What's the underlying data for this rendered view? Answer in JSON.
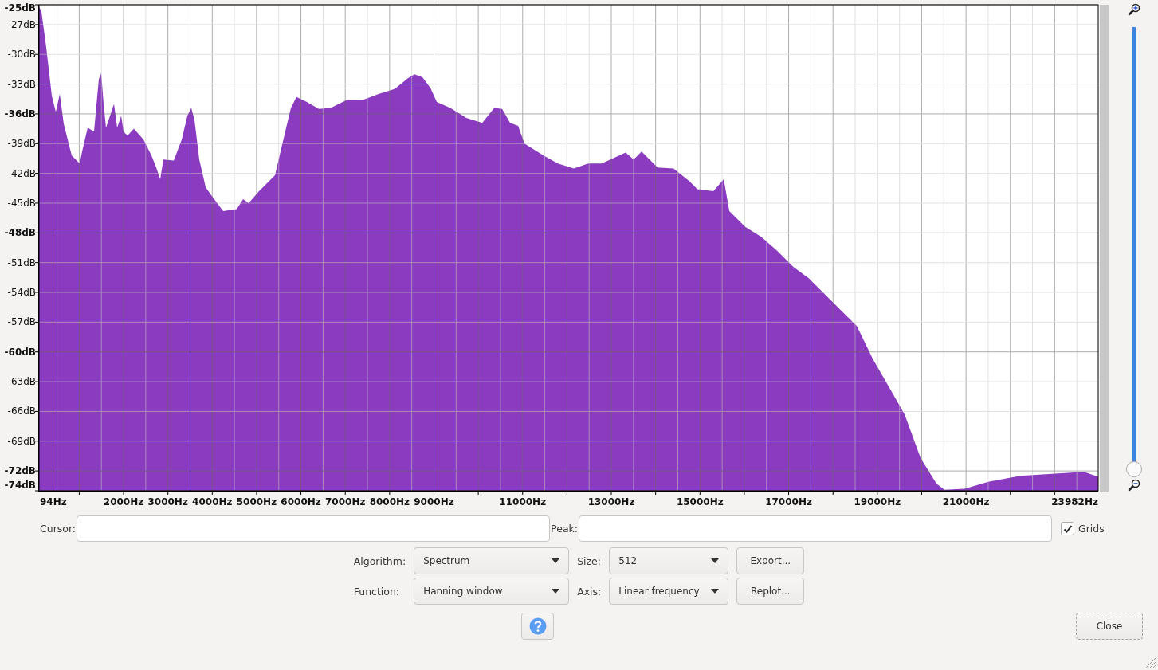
{
  "spectrum_plot": {
    "chart_data": {
      "type": "area",
      "grid": true,
      "xlim": [
        94,
        23982
      ],
      "ylim": [
        -74,
        -25
      ],
      "xticks": [
        {
          "value": 94,
          "label": "94Hz"
        },
        {
          "value": 2000,
          "label": "2000Hz"
        },
        {
          "value": 3000,
          "label": "3000Hz"
        },
        {
          "value": 4000,
          "label": "4000Hz"
        },
        {
          "value": 5000,
          "label": "5000Hz"
        },
        {
          "value": 6000,
          "label": "6000Hz"
        },
        {
          "value": 7000,
          "label": "7000Hz"
        },
        {
          "value": 8000,
          "label": "8000Hz"
        },
        {
          "value": 9000,
          "label": "9000Hz"
        },
        {
          "value": 11000,
          "label": "11000Hz"
        },
        {
          "value": 13000,
          "label": "13000Hz"
        },
        {
          "value": 15000,
          "label": "15000Hz"
        },
        {
          "value": 17000,
          "label": "17000Hz"
        },
        {
          "value": 19000,
          "label": "19000Hz"
        },
        {
          "value": 21000,
          "label": "21000Hz"
        },
        {
          "value": 23982,
          "label": "23982Hz"
        }
      ],
      "yticks": [
        {
          "value": -25,
          "label": "-25dB"
        },
        {
          "value": -27,
          "label": "-27dB"
        },
        {
          "value": -30,
          "label": "-30dB"
        },
        {
          "value": -33,
          "label": "-33dB"
        },
        {
          "value": -36,
          "label": "-36dB"
        },
        {
          "value": -39,
          "label": "-39dB"
        },
        {
          "value": -42,
          "label": "-42dB"
        },
        {
          "value": -45,
          "label": "-45dB"
        },
        {
          "value": -48,
          "label": "-48dB"
        },
        {
          "value": -51,
          "label": "-51dB"
        },
        {
          "value": -54,
          "label": "-54dB"
        },
        {
          "value": -57,
          "label": "-57dB"
        },
        {
          "value": -60,
          "label": "-60dB"
        },
        {
          "value": -63,
          "label": "-63dB"
        },
        {
          "value": -66,
          "label": "-66dB"
        },
        {
          "value": -69,
          "label": "-69dB"
        },
        {
          "value": -72,
          "label": "-72dB"
        },
        {
          "value": -74,
          "label": "-74dB"
        }
      ],
      "x": [
        94,
        148,
        256,
        382,
        472,
        561,
        651,
        831,
        1011,
        1065,
        1191,
        1334,
        1442,
        1496,
        1550,
        1604,
        1694,
        1784,
        1856,
        1946,
        2000,
        2089,
        2233,
        2449,
        2629,
        2736,
        2826,
        2898,
        3132,
        3312,
        3438,
        3527,
        3599,
        3707,
        3851,
        3977,
        4246,
        4552,
        4696,
        4822,
        5055,
        5415,
        5540,
        5774,
        5900,
        6134,
        6404,
        6673,
        7033,
        7392,
        7752,
        8111,
        8417,
        8561,
        8741,
        8921,
        9064,
        9370,
        9730,
        10089,
        10359,
        10538,
        10718,
        10898,
        11042,
        11473,
        11796,
        12156,
        12480,
        12785,
        13324,
        13504,
        13684,
        14044,
        14403,
        14762,
        14942,
        15302,
        15536,
        15662,
        16021,
        16381,
        16740,
        17100,
        17459,
        17818,
        18178,
        18538,
        18897,
        19257,
        19616,
        19976,
        20336,
        20516,
        20966,
        21505,
        22224,
        22943,
        23663,
        23982
      ],
      "values": [
        -25.2,
        -25.7,
        -29.3,
        -34.2,
        -35.8,
        -34.0,
        -37.0,
        -40.2,
        -41.0,
        -39.8,
        -37.4,
        -37.8,
        -32.5,
        -31.9,
        -35.0,
        -37.4,
        -36.2,
        -35.0,
        -37.4,
        -36.2,
        -37.8,
        -38.2,
        -37.5,
        -38.6,
        -40.2,
        -41.4,
        -42.6,
        -40.6,
        -40.7,
        -38.6,
        -36.2,
        -35.4,
        -36.6,
        -40.6,
        -43.4,
        -44.2,
        -45.8,
        -45.6,
        -44.6,
        -45.0,
        -43.8,
        -42.2,
        -39.8,
        -35.4,
        -34.3,
        -34.8,
        -35.5,
        -35.4,
        -34.6,
        -34.6,
        -34.0,
        -33.5,
        -32.4,
        -32.0,
        -32.3,
        -33.4,
        -34.8,
        -35.4,
        -36.4,
        -36.9,
        -35.4,
        -35.5,
        -36.9,
        -37.2,
        -39.0,
        -40.2,
        -41.0,
        -41.5,
        -41.0,
        -41.0,
        -39.9,
        -40.6,
        -39.8,
        -41.4,
        -41.5,
        -42.8,
        -43.6,
        -43.8,
        -42.6,
        -45.8,
        -47.4,
        -48.4,
        -49.8,
        -51.4,
        -52.6,
        -54.2,
        -55.8,
        -57.4,
        -60.7,
        -63.5,
        -66.3,
        -70.7,
        -73.3,
        -73.9,
        -73.8,
        -73.1,
        -72.5,
        -72.3,
        -72.1,
        -72.6
      ]
    }
  },
  "zoom_slider": {
    "level": 0
  },
  "cursor": {
    "label": "Cursor:"
  },
  "peak": {
    "label": "Peak:"
  },
  "grids": {
    "label": "Grids",
    "checked": true
  },
  "algorithm": {
    "label": "Algorithm:",
    "value": "Spectrum"
  },
  "size": {
    "label": "Size:",
    "value": "512"
  },
  "export_button": "Export...",
  "function": {
    "label": "Function:",
    "value": "Hanning window"
  },
  "axis": {
    "label": "Axis:",
    "value": "Linear frequency"
  },
  "replot_button": "Replot...",
  "close_button": "Close"
}
